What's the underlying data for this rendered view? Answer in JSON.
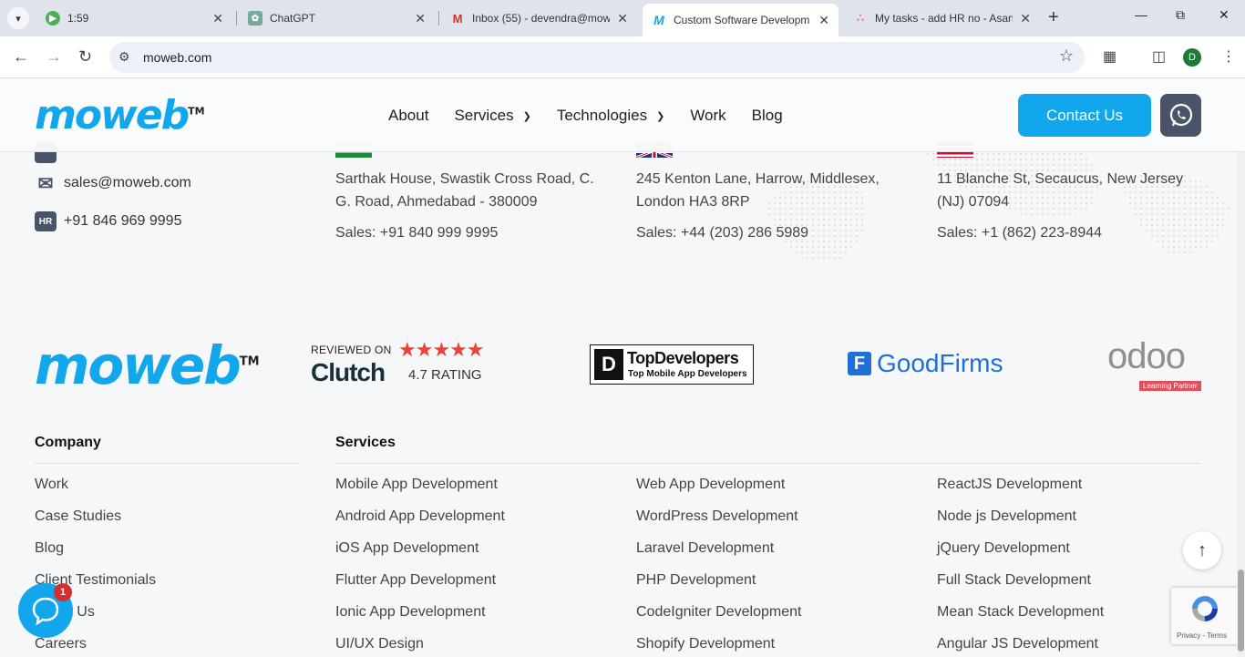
{
  "browser": {
    "tabs": [
      {
        "title": "1:59",
        "icon": "play-icon",
        "active": false
      },
      {
        "title": "ChatGPT",
        "icon": "chatgpt-icon",
        "active": false
      },
      {
        "title": "Inbox (55) - devendra@mow",
        "icon": "gmail-icon",
        "active": false
      },
      {
        "title": "Custom Software Developm",
        "icon": "moweb-icon",
        "active": true
      },
      {
        "title": "My tasks - add HR no - Asan",
        "icon": "asana-icon",
        "active": false
      }
    ],
    "url": "moweb.com",
    "profile_initial": "D"
  },
  "header": {
    "logo_text": "moweb",
    "logo_tm": "TM",
    "nav": [
      {
        "label": "About",
        "dropdown": false
      },
      {
        "label": "Services",
        "dropdown": true
      },
      {
        "label": "Technologies",
        "dropdown": true
      },
      {
        "label": "Work",
        "dropdown": false
      },
      {
        "label": "Blog",
        "dropdown": false
      }
    ],
    "contact_label": "Contact Us"
  },
  "contact": {
    "email": "sales@moweb.com",
    "hr_badge": "HR",
    "hr_phone": "+91 846 969 9995"
  },
  "offices": [
    {
      "address": "Sarthak House, Swastik Cross Road, C. G. Road, Ahmedabad - 380009",
      "sales": "Sales: +91 840 999 9995"
    },
    {
      "address": "245 Kenton Lane, Harrow, Middlesex, London HA3 8RP",
      "sales": "Sales: +44 (203) 286 5989"
    },
    {
      "address": "11 Blanche St, Secaucus, New Jersey (NJ) 07094",
      "sales": "Sales: +1 (862) 223-8944"
    }
  ],
  "badges": {
    "footer_logo": "moweb",
    "footer_tm": "TM",
    "clutch_reviewed": "REVIEWED ON",
    "clutch_name": "Clutch",
    "clutch_rating": "4.7 RATING",
    "topdev_title": "TopDevelopers",
    "topdev_sub": "Top Mobile App Developers",
    "goodfirms": "GoodFirms",
    "odoo": "odoo",
    "odoo_tag": "Learning Partner"
  },
  "footer": {
    "company_heading": "Company",
    "company_links": [
      "Work",
      "Case Studies",
      "Blog",
      "Client Testimonials",
      "About Us",
      "Careers"
    ],
    "services_heading": "Services",
    "services_col1": [
      "Mobile App Development",
      "Android App Development",
      "iOS App Development",
      "Flutter App Development",
      "Ionic App Development",
      "UI/UX Design"
    ],
    "services_col2": [
      "Web App Development",
      "WordPress Development",
      "Laravel Development",
      "PHP Development",
      "CodeIgniter Development",
      "Shopify Development"
    ],
    "services_col3": [
      "ReactJS Development",
      "Node js Development",
      "jQuery Development",
      "Full Stack Development",
      "Mean Stack Development",
      "Angular JS Development"
    ]
  },
  "widgets": {
    "chat_badge": "1",
    "recaptcha_text": "Privacy - Terms"
  }
}
